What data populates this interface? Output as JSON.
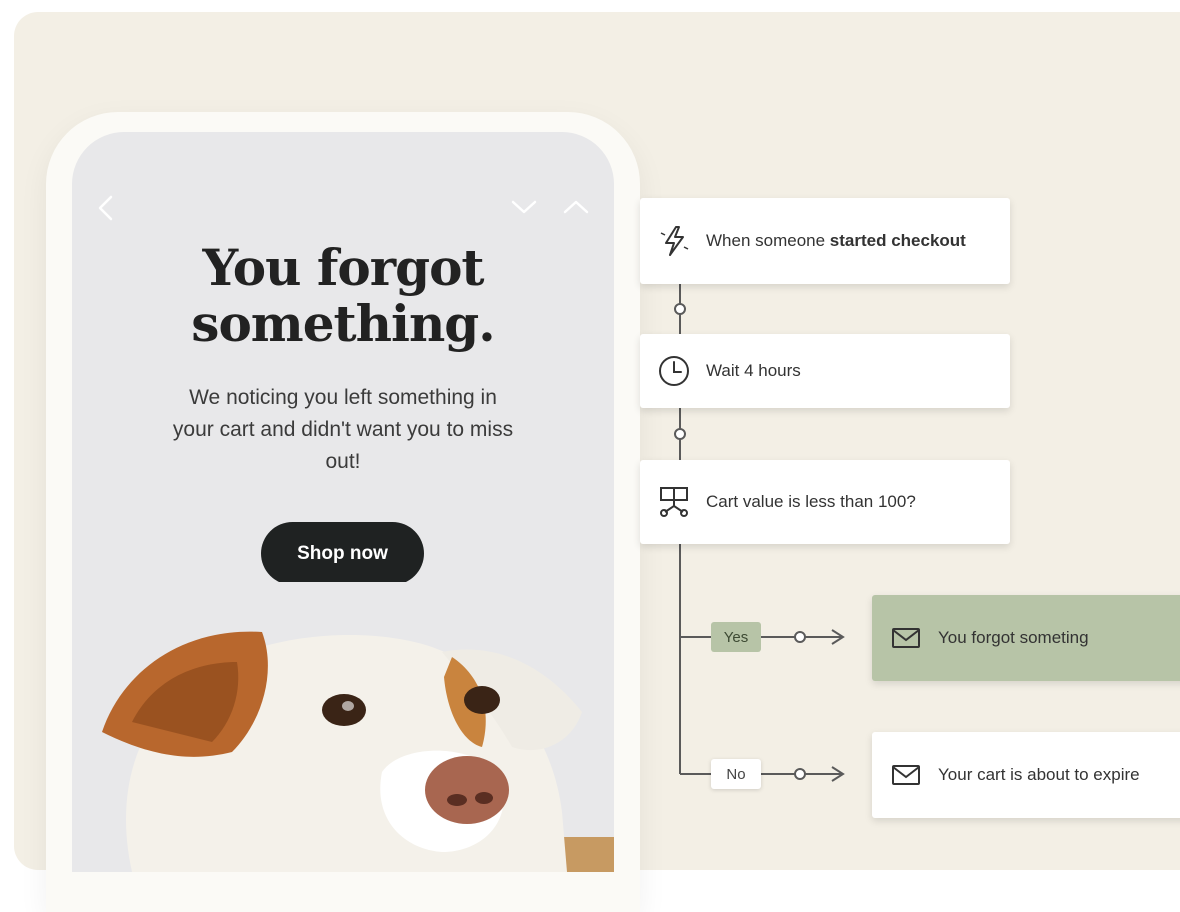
{
  "email_preview": {
    "headline": "You forgot something.",
    "body": "We noticing you left something in your cart and didn't want you to miss out!",
    "button_label": "Shop now"
  },
  "flow": {
    "trigger_prefix": "When someone ",
    "trigger_bold": "started checkout",
    "wait_label": "Wait 4 hours",
    "condition_label": "Cart value is less than 100?",
    "yes_label": "Yes",
    "no_label": "No",
    "yes_email": "You forgot someting",
    "no_email": "Your cart is about to expire"
  },
  "icons": [
    "chevron-left-icon",
    "chevron-down-icon",
    "chevron-up-icon",
    "lightning-icon",
    "clock-icon",
    "split-icon",
    "envelope-icon"
  ],
  "colors": {
    "background": "#f3efe5",
    "button": "#1f2222",
    "yes_branch": "#b7c4a7",
    "node": "#ffffff"
  }
}
